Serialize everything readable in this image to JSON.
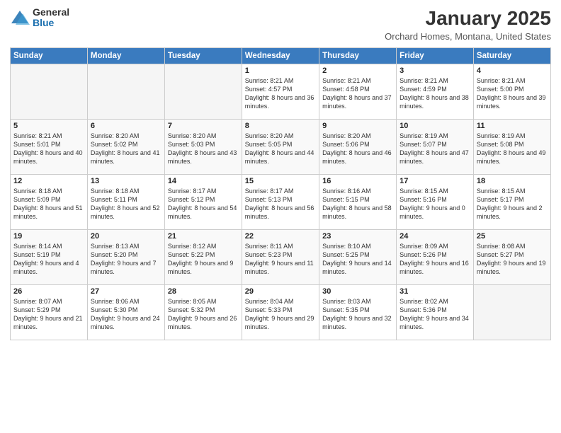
{
  "logo": {
    "general": "General",
    "blue": "Blue"
  },
  "header": {
    "month": "January 2025",
    "location": "Orchard Homes, Montana, United States"
  },
  "weekdays": [
    "Sunday",
    "Monday",
    "Tuesday",
    "Wednesday",
    "Thursday",
    "Friday",
    "Saturday"
  ],
  "weeks": [
    [
      {
        "day": "",
        "empty": true
      },
      {
        "day": "",
        "empty": true
      },
      {
        "day": "",
        "empty": true
      },
      {
        "day": "1",
        "sunrise": "8:21 AM",
        "sunset": "4:57 PM",
        "daylight": "8 hours and 36 minutes."
      },
      {
        "day": "2",
        "sunrise": "8:21 AM",
        "sunset": "4:58 PM",
        "daylight": "8 hours and 37 minutes."
      },
      {
        "day": "3",
        "sunrise": "8:21 AM",
        "sunset": "4:59 PM",
        "daylight": "8 hours and 38 minutes."
      },
      {
        "day": "4",
        "sunrise": "8:21 AM",
        "sunset": "5:00 PM",
        "daylight": "8 hours and 39 minutes."
      }
    ],
    [
      {
        "day": "5",
        "sunrise": "8:21 AM",
        "sunset": "5:01 PM",
        "daylight": "8 hours and 40 minutes."
      },
      {
        "day": "6",
        "sunrise": "8:20 AM",
        "sunset": "5:02 PM",
        "daylight": "8 hours and 41 minutes."
      },
      {
        "day": "7",
        "sunrise": "8:20 AM",
        "sunset": "5:03 PM",
        "daylight": "8 hours and 43 minutes."
      },
      {
        "day": "8",
        "sunrise": "8:20 AM",
        "sunset": "5:05 PM",
        "daylight": "8 hours and 44 minutes."
      },
      {
        "day": "9",
        "sunrise": "8:20 AM",
        "sunset": "5:06 PM",
        "daylight": "8 hours and 46 minutes."
      },
      {
        "day": "10",
        "sunrise": "8:19 AM",
        "sunset": "5:07 PM",
        "daylight": "8 hours and 47 minutes."
      },
      {
        "day": "11",
        "sunrise": "8:19 AM",
        "sunset": "5:08 PM",
        "daylight": "8 hours and 49 minutes."
      }
    ],
    [
      {
        "day": "12",
        "sunrise": "8:18 AM",
        "sunset": "5:09 PM",
        "daylight": "8 hours and 51 minutes."
      },
      {
        "day": "13",
        "sunrise": "8:18 AM",
        "sunset": "5:11 PM",
        "daylight": "8 hours and 52 minutes."
      },
      {
        "day": "14",
        "sunrise": "8:17 AM",
        "sunset": "5:12 PM",
        "daylight": "8 hours and 54 minutes."
      },
      {
        "day": "15",
        "sunrise": "8:17 AM",
        "sunset": "5:13 PM",
        "daylight": "8 hours and 56 minutes."
      },
      {
        "day": "16",
        "sunrise": "8:16 AM",
        "sunset": "5:15 PM",
        "daylight": "8 hours and 58 minutes."
      },
      {
        "day": "17",
        "sunrise": "8:15 AM",
        "sunset": "5:16 PM",
        "daylight": "9 hours and 0 minutes."
      },
      {
        "day": "18",
        "sunrise": "8:15 AM",
        "sunset": "5:17 PM",
        "daylight": "9 hours and 2 minutes."
      }
    ],
    [
      {
        "day": "19",
        "sunrise": "8:14 AM",
        "sunset": "5:19 PM",
        "daylight": "9 hours and 4 minutes."
      },
      {
        "day": "20",
        "sunrise": "8:13 AM",
        "sunset": "5:20 PM",
        "daylight": "9 hours and 7 minutes."
      },
      {
        "day": "21",
        "sunrise": "8:12 AM",
        "sunset": "5:22 PM",
        "daylight": "9 hours and 9 minutes."
      },
      {
        "day": "22",
        "sunrise": "8:11 AM",
        "sunset": "5:23 PM",
        "daylight": "9 hours and 11 minutes."
      },
      {
        "day": "23",
        "sunrise": "8:10 AM",
        "sunset": "5:25 PM",
        "daylight": "9 hours and 14 minutes."
      },
      {
        "day": "24",
        "sunrise": "8:09 AM",
        "sunset": "5:26 PM",
        "daylight": "9 hours and 16 minutes."
      },
      {
        "day": "25",
        "sunrise": "8:08 AM",
        "sunset": "5:27 PM",
        "daylight": "9 hours and 19 minutes."
      }
    ],
    [
      {
        "day": "26",
        "sunrise": "8:07 AM",
        "sunset": "5:29 PM",
        "daylight": "9 hours and 21 minutes."
      },
      {
        "day": "27",
        "sunrise": "8:06 AM",
        "sunset": "5:30 PM",
        "daylight": "9 hours and 24 minutes."
      },
      {
        "day": "28",
        "sunrise": "8:05 AM",
        "sunset": "5:32 PM",
        "daylight": "9 hours and 26 minutes."
      },
      {
        "day": "29",
        "sunrise": "8:04 AM",
        "sunset": "5:33 PM",
        "daylight": "9 hours and 29 minutes."
      },
      {
        "day": "30",
        "sunrise": "8:03 AM",
        "sunset": "5:35 PM",
        "daylight": "9 hours and 32 minutes."
      },
      {
        "day": "31",
        "sunrise": "8:02 AM",
        "sunset": "5:36 PM",
        "daylight": "9 hours and 34 minutes."
      },
      {
        "day": "",
        "empty": true
      }
    ]
  ]
}
